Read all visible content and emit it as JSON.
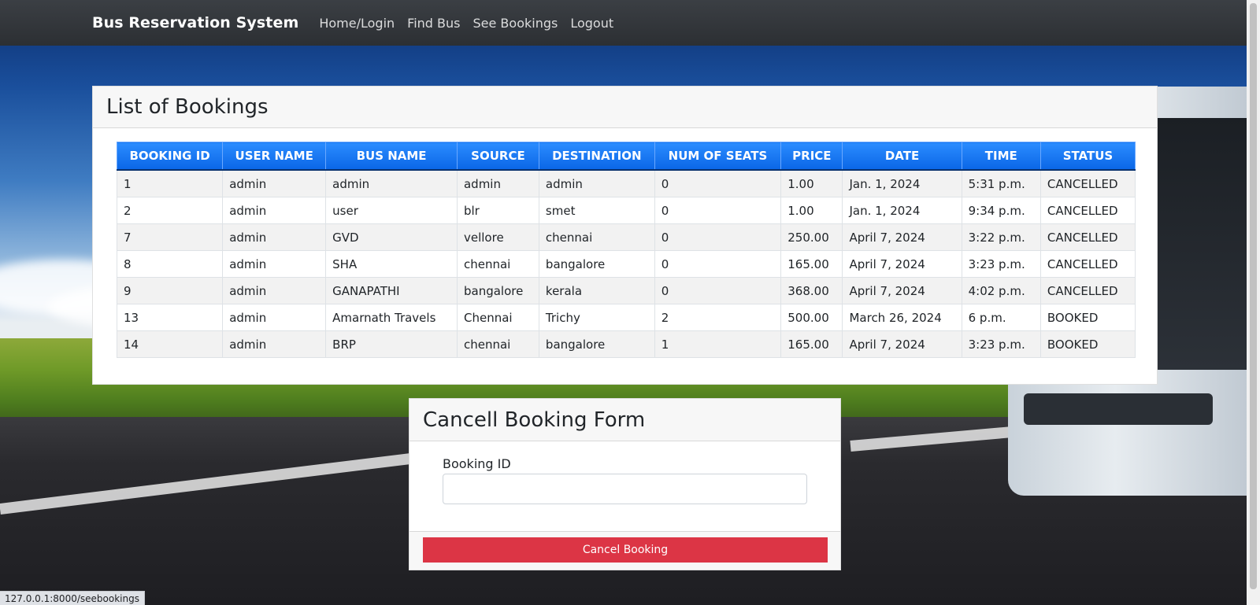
{
  "navbar": {
    "brand": "Bus Reservation System",
    "links": [
      "Home/Login",
      "Find Bus",
      "See Bookings",
      "Logout"
    ]
  },
  "bookings": {
    "title": "List of Bookings",
    "headers": [
      "BOOKING ID",
      "USER NAME",
      "BUS NAME",
      "SOURCE",
      "DESTINATION",
      "NUM OF SEATS",
      "PRICE",
      "DATE",
      "TIME",
      "STATUS"
    ],
    "rows": [
      [
        "1",
        "admin",
        "admin",
        "admin",
        "admin",
        "0",
        "1.00",
        "Jan. 1, 2024",
        "5:31 p.m.",
        "CANCELLED"
      ],
      [
        "2",
        "admin",
        "user",
        "blr",
        "smet",
        "0",
        "1.00",
        "Jan. 1, 2024",
        "9:34 p.m.",
        "CANCELLED"
      ],
      [
        "7",
        "admin",
        "GVD",
        "vellore",
        "chennai",
        "0",
        "250.00",
        "April 7, 2024",
        "3:22 p.m.",
        "CANCELLED"
      ],
      [
        "8",
        "admin",
        "SHA",
        "chennai",
        "bangalore",
        "0",
        "165.00",
        "April 7, 2024",
        "3:23 p.m.",
        "CANCELLED"
      ],
      [
        "9",
        "admin",
        "GANAPATHI",
        "bangalore",
        "kerala",
        "0",
        "368.00",
        "April 7, 2024",
        "4:02 p.m.",
        "CANCELLED"
      ],
      [
        "13",
        "admin",
        "Amarnath Travels",
        "Chennai",
        "Trichy",
        "2",
        "500.00",
        "March 26, 2024",
        "6 p.m.",
        "BOOKED"
      ],
      [
        "14",
        "admin",
        "BRP",
        "chennai",
        "bangalore",
        "1",
        "165.00",
        "April 7, 2024",
        "3:23 p.m.",
        "BOOKED"
      ]
    ]
  },
  "cancel_form": {
    "title": "Cancell Booking Form",
    "booking_id_label": "Booking ID",
    "booking_id_value": "",
    "button_label": "Cancel Booking"
  },
  "status_bar": {
    "url": "127.0.0.1:8000/seebookings"
  },
  "colors": {
    "navbar": "#343a40",
    "table_header": "#1a73f5",
    "danger_button": "#dc3545"
  }
}
